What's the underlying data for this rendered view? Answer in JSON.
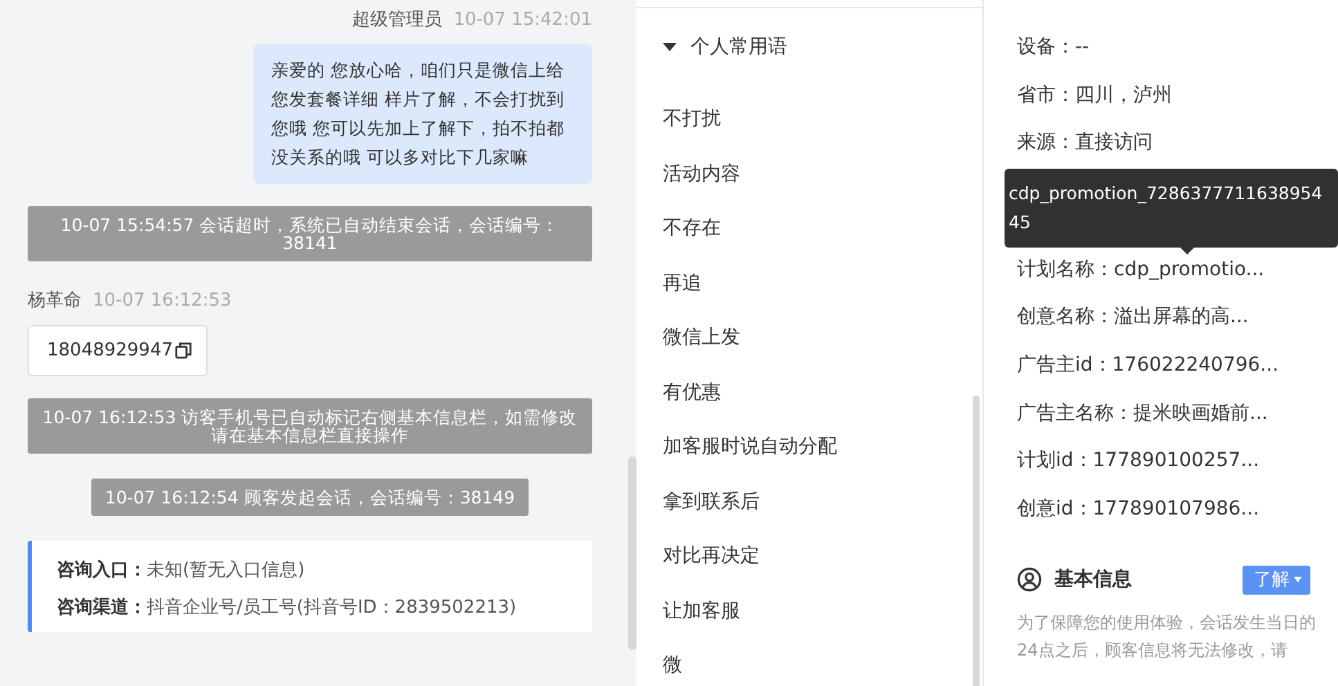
{
  "chat": {
    "messages": [
      {
        "kind": "agent",
        "sender": "超级管理员",
        "time": "10-07 15:42:01",
        "text": "亲爱的 您放心哈，咱们只是微信上给您发套餐详细 样片了解，不会打扰到您哦 您可以先加上了解下，拍不拍都没关系的哦 可以多对比下几家嘛"
      },
      {
        "kind": "system",
        "text": "10-07 15:54:57 会话超时，系统已自动结束会话，会话编号：38141"
      },
      {
        "kind": "visitor",
        "sender": "杨革命",
        "time": "10-07 16:12:53",
        "text": "18048929947"
      },
      {
        "kind": "system",
        "text": "10-07 16:12:53 访客手机号已自动标记右侧基本信息栏，如需修改请在基本信息栏直接操作"
      },
      {
        "kind": "system",
        "text": "10-07 16:12:54 顾客发起会话，会话编号：38149"
      },
      {
        "kind": "info",
        "rows": [
          {
            "label": "咨询入口：",
            "value": "未知(暂无入口信息)"
          },
          {
            "label": "咨询渠道：",
            "value": "抖音企业号/员工号(抖音号ID：2839502213)"
          }
        ]
      }
    ]
  },
  "phrases": {
    "group": {
      "title": "个人常用语",
      "expanded": true
    },
    "items": [
      "不打扰",
      "活动内容",
      "不存在",
      "再追",
      "微信上发",
      "有优惠",
      "加客服时说自动分配",
      "拿到联系后",
      "对比再决定",
      "让加客服",
      "微"
    ]
  },
  "visitor_info": {
    "fields": [
      "设备：--",
      "省市：四川，泸州",
      "来源：直接访问",
      "计划名称：cdp_promotio...",
      "创意名称：溢出屏幕的高...",
      "广告主id：176022240796...",
      "广告主名称：提米映画婚前...",
      "计划id：177890100257...",
      "创意id：177890107986..."
    ],
    "tooltip": "cdp_promotion_728637771163895445",
    "basic_info": {
      "title": "基本信息",
      "button": "了解",
      "note": "为了保障您的使用体验，会话发生当日的24点之后，顾客信息将无法修改，请"
    }
  }
}
